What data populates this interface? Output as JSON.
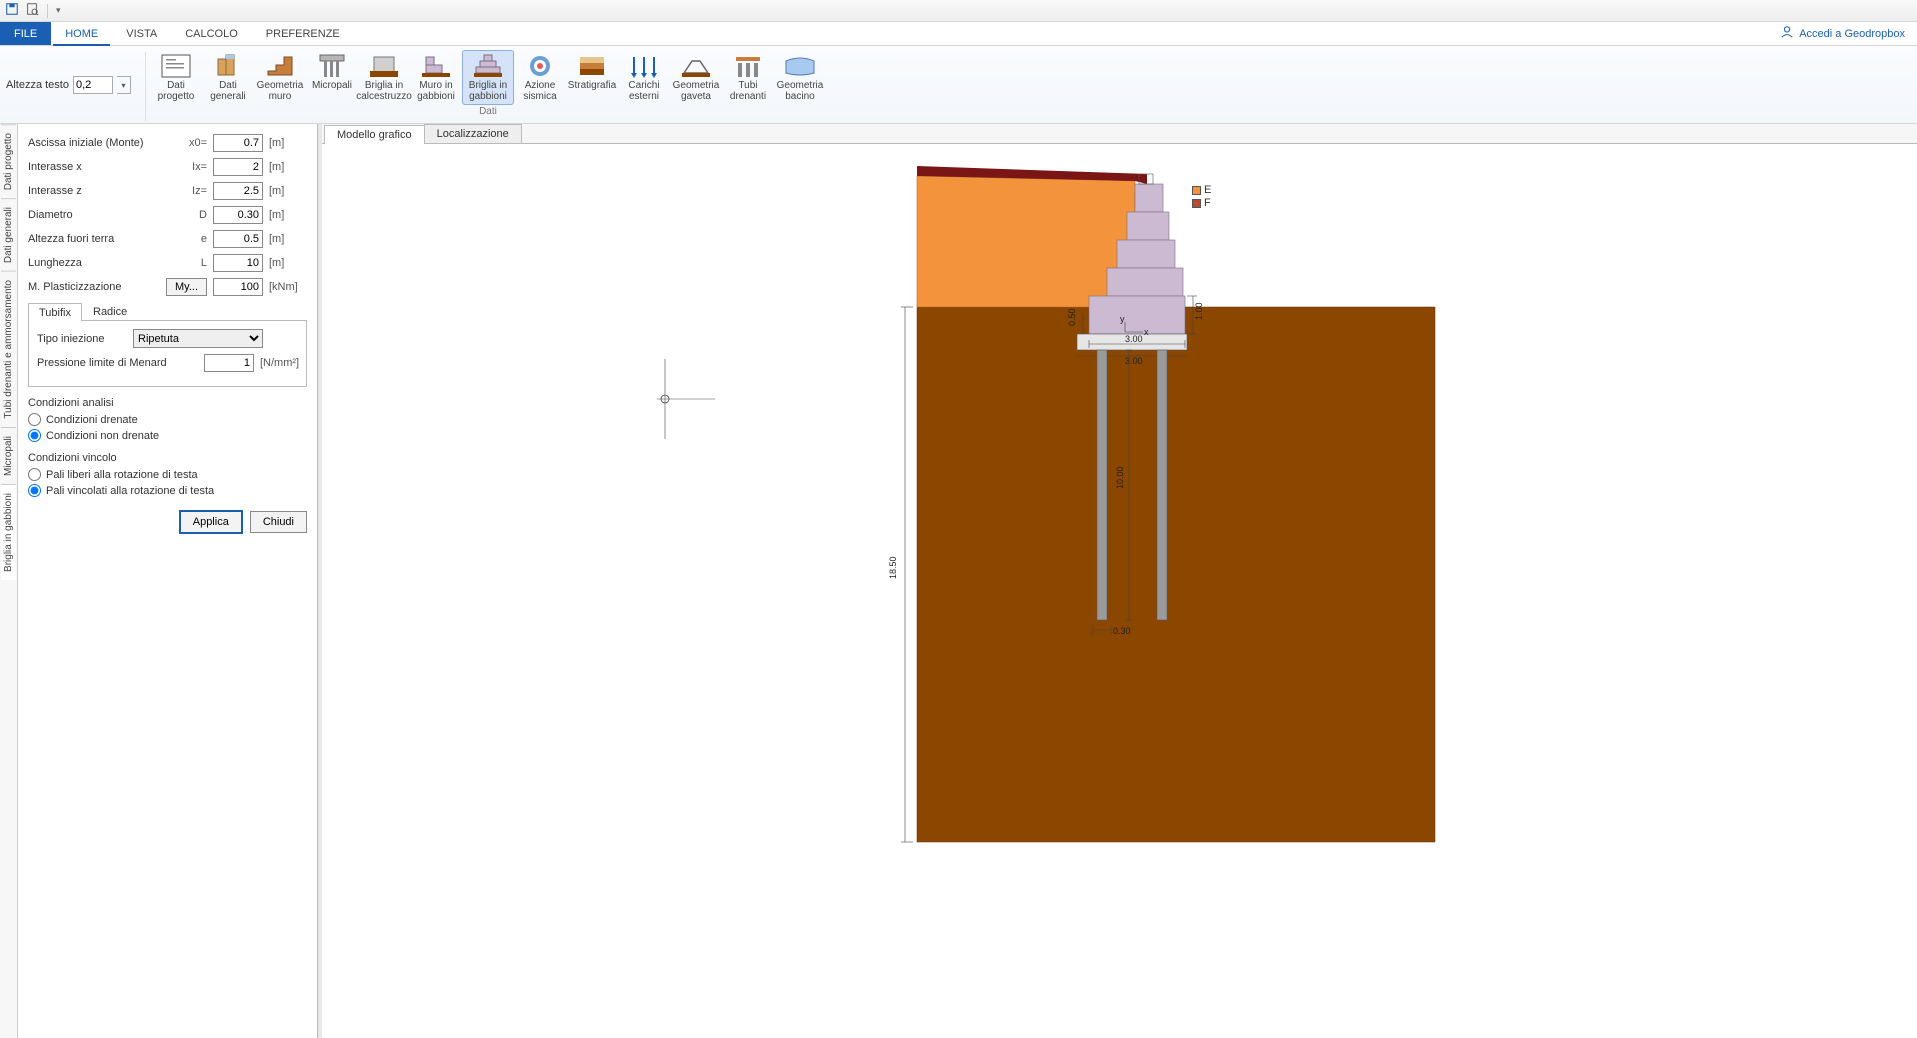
{
  "qat": {
    "save": "save-icon",
    "preview": "magnify-icon"
  },
  "tabs": {
    "file": "FILE",
    "home": "HOME",
    "vista": "VISTA",
    "calcolo": "CALCOLO",
    "preferenze": "PREFERENZE"
  },
  "account": "Accedi a Geodropbox",
  "ribbon": {
    "altezza_testo_label": "Altezza testo",
    "altezza_testo_value": "0,2",
    "buttons": [
      {
        "id": "dati-progetto",
        "l1": "Dati",
        "l2": "progetto"
      },
      {
        "id": "dati-generali",
        "l1": "Dati",
        "l2": "generali"
      },
      {
        "id": "geometria-muro",
        "l1": "Geometria",
        "l2": "muro"
      },
      {
        "id": "micropali",
        "l1": "Micropali",
        "l2": ""
      },
      {
        "id": "briglia-calcestruzzo",
        "l1": "Briglia in",
        "l2": "calcestruzzo"
      },
      {
        "id": "muro-gabbioni",
        "l1": "Muro in",
        "l2": "gabbioni"
      },
      {
        "id": "briglia-gabbioni",
        "l1": "Briglia in",
        "l2": "gabbioni",
        "active": true
      },
      {
        "id": "azione-sismica",
        "l1": "Azione",
        "l2": "sismica"
      },
      {
        "id": "stratigrafia",
        "l1": "Stratigrafia",
        "l2": ""
      },
      {
        "id": "carichi-esterni",
        "l1": "Carichi",
        "l2": "esterni"
      },
      {
        "id": "geometria-gaveta",
        "l1": "Geometria",
        "l2": "gaveta"
      },
      {
        "id": "tubi-drenanti",
        "l1": "Tubi",
        "l2": "drenanti"
      },
      {
        "id": "geometria-bacino",
        "l1": "Geometria",
        "l2": "bacino"
      }
    ],
    "group_label": "Dati"
  },
  "sidetabs": [
    "Dati progetto",
    "Dati generali",
    "Tubi drenanti e ammorsamento",
    "Micropali",
    "Briglia in gabbioni"
  ],
  "sidetab_active_index": 4,
  "panel": {
    "fields": [
      {
        "label": "Ascissa iniziale (Monte)",
        "sym": "x0=",
        "val": "0.7",
        "unit": "[m]"
      },
      {
        "label": "Interasse x",
        "sym": "Ix=",
        "val": "2",
        "unit": "[m]"
      },
      {
        "label": "Interasse z",
        "sym": "Iz=",
        "val": "2.5",
        "unit": "[m]"
      },
      {
        "label": "Diametro",
        "sym": "D",
        "val": "0.30",
        "unit": "[m]"
      },
      {
        "label": "Altezza fuori terra",
        "sym": "e",
        "val": "0.5",
        "unit": "[m]"
      },
      {
        "label": "Lunghezza",
        "sym": "L",
        "val": "10",
        "unit": "[m]"
      }
    ],
    "m_plast_label": "M. Plasticizzazione",
    "m_plast_btn": "My...",
    "m_plast_val": "100",
    "m_plast_unit": "[kNm]",
    "subtabs": [
      "Tubifix",
      "Radice"
    ],
    "tipo_iniezione_label": "Tipo iniezione",
    "tipo_iniezione_value": "Ripetuta",
    "pressione_label": "Pressione limite di Menard",
    "pressione_val": "1",
    "pressione_unit": "[N/mm²]",
    "cond_analisi_title": "Condizioni analisi",
    "cond_drenate": "Condizioni drenate",
    "cond_non_drenate": "Condizioni non drenate",
    "cond_vincolo_title": "Condizioni vincolo",
    "pali_liberi": "Pali liberi alla rotazione di testa",
    "pali_vincolati": "Pali vincolati alla rotazione di testa",
    "applica": "Applica",
    "chiudi": "Chiudi"
  },
  "canvas_tabs": [
    "Modello grafico",
    "Localizzazione"
  ],
  "legend": [
    {
      "k": "E",
      "c": "#f3943c"
    },
    {
      "k": "F",
      "c": "#b94b2e"
    }
  ],
  "dims": {
    "depth": "18.50",
    "pile_len": "10.00",
    "base_w": "3.00",
    "base_w2": "3.00",
    "pile_d": "0.30",
    "top_h": "0.50",
    "side_h": "1.00"
  }
}
